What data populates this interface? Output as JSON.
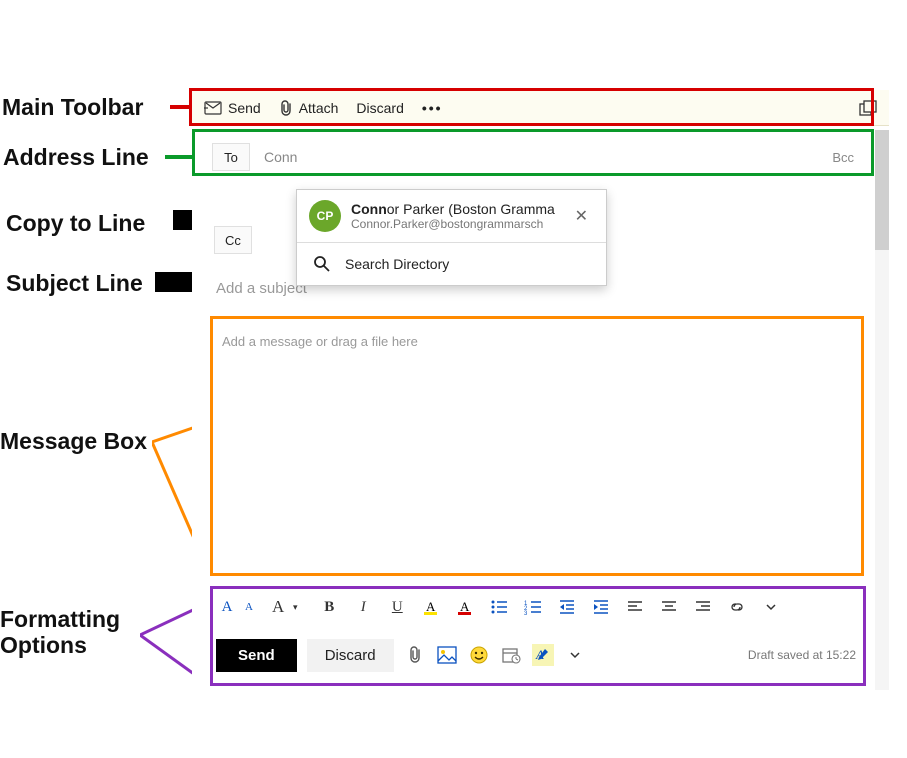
{
  "annotations": {
    "main_toolbar": "Main Toolbar",
    "address_line": "Address Line",
    "copy_to_line": "Copy to Line",
    "subject_line": "Subject Line",
    "message_box": "Message Box",
    "formatting_options": "Formatting\nOptions"
  },
  "toolbar": {
    "send": "Send",
    "attach": "Attach",
    "discard": "Discard"
  },
  "address": {
    "to_label": "To",
    "to_value": "Conn",
    "bcc_label": "Bcc"
  },
  "cc": {
    "label": "Cc"
  },
  "subject": {
    "placeholder": "Add a subject"
  },
  "message": {
    "placeholder": "Add a message or drag a file here"
  },
  "suggest": {
    "avatar_initials": "CP",
    "name_prefix_bold": "Conn",
    "name_rest": "or Parker (Boston Gramma",
    "email": "Connor.Parker@bostongrammarsch",
    "search_label": "Search Directory"
  },
  "bottom": {
    "send": "Send",
    "discard": "Discard",
    "draft_saved": "Draft saved at 15:22"
  }
}
